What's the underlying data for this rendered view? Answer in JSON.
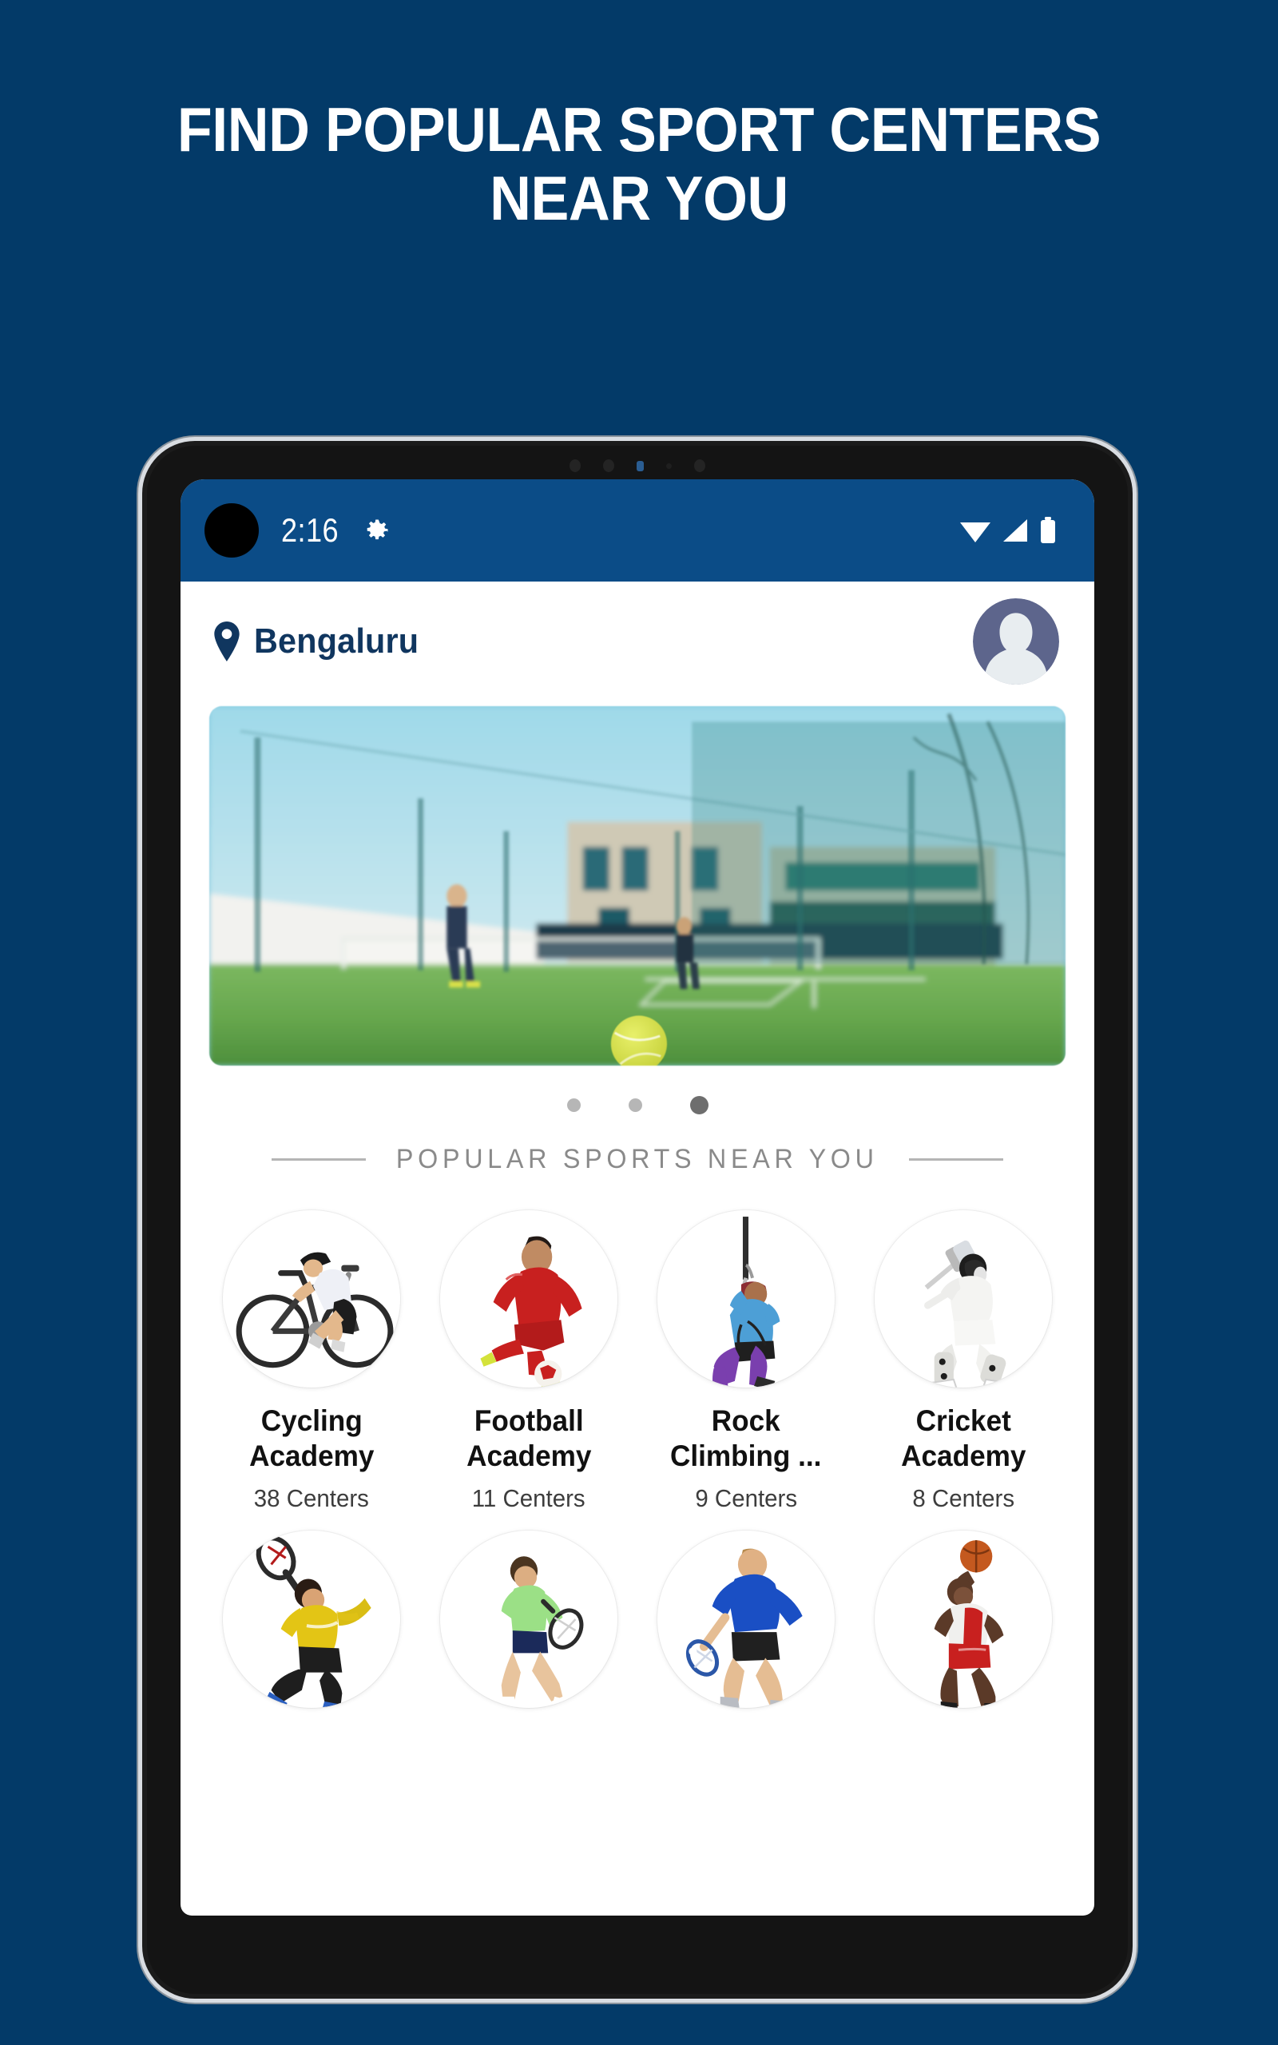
{
  "promo": {
    "headline_line1": "FIND POPULAR SPORT CENTERS",
    "headline_line2": "NEAR YOU",
    "background_color": "#033a68",
    "text_color": "#ffffff"
  },
  "statusbar": {
    "time": "2:16",
    "icons": [
      "gear-icon",
      "wifi-icon",
      "cellular-signal-icon",
      "battery-icon"
    ],
    "background_color": "#0b4c87"
  },
  "app_header": {
    "location_icon": "location-pin-icon",
    "location": "Bengaluru",
    "location_color": "#10365f",
    "avatar": "user-avatar"
  },
  "carousel": {
    "slide_alt": "tennis court with ball on green turf",
    "dots_total": 3,
    "active_dot_index": 2,
    "dot_color": "#b6b6b6",
    "dot_active_color": "#6e6e6e"
  },
  "section": {
    "title": "POPULAR  SPORTS  NEAR  YOU",
    "title_color": "#8a8a8a",
    "rule_color": "#b5b5b5"
  },
  "sports": {
    "row1": [
      {
        "icon": "cycling-icon",
        "name_line1": "Cycling",
        "name_line2": "Academy",
        "count": "38 Centers"
      },
      {
        "icon": "football-icon",
        "name_line1": "Football",
        "name_line2": "Academy",
        "count": "11 Centers"
      },
      {
        "icon": "rock-climbing-icon",
        "name_line1": "Rock",
        "name_line2": "Climbing ...",
        "count": "9 Centers"
      },
      {
        "icon": "cricket-icon",
        "name_line1": "Cricket",
        "name_line2": "Academy",
        "count": "8 Centers"
      }
    ],
    "row2": [
      {
        "icon": "badminton-icon"
      },
      {
        "icon": "tennis-icon"
      },
      {
        "icon": "squash-icon"
      },
      {
        "icon": "basketball-icon"
      }
    ]
  }
}
